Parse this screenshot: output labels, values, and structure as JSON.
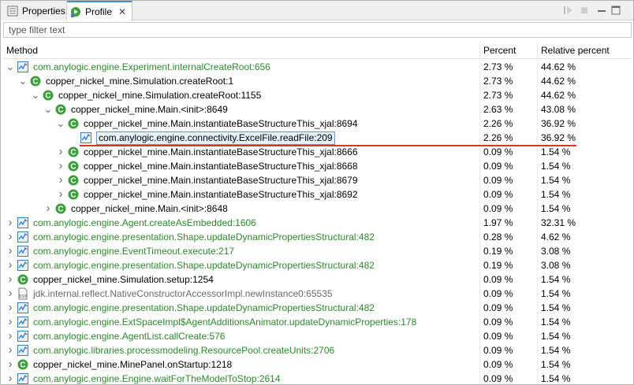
{
  "tabs": {
    "properties_label": "Properties",
    "profile_label": "Profile",
    "close_glyph": "✕"
  },
  "filter": {
    "placeholder": "type filter text"
  },
  "columns": {
    "method": "Method",
    "percent": "Percent",
    "relative": "Relative percent"
  },
  "colors": {
    "green_text": "#2a8a2a",
    "selection": "#e5f1fb",
    "selection_border": "#5b9bd5",
    "annotation": "#e03030",
    "class_icon": "#3e9e3e",
    "method_icon": "#3a7fc6"
  },
  "rows": [
    {
      "depth": 0,
      "expand": "open",
      "icon": "method-icon",
      "color": "green",
      "label": "com.anylogic.engine.Experiment.internalCreateRoot:656",
      "percent": "2.73 %",
      "relative": "44.62 %"
    },
    {
      "depth": 1,
      "expand": "open",
      "icon": "class-icon",
      "color": "black",
      "label": "copper_nickel_mine.Simulation.createRoot:1",
      "percent": "2.73 %",
      "relative": "44.62 %"
    },
    {
      "depth": 2,
      "expand": "open",
      "icon": "class-icon",
      "color": "black",
      "label": "copper_nickel_mine.Simulation.createRoot:1155",
      "percent": "2.73 %",
      "relative": "44.62 %"
    },
    {
      "depth": 3,
      "expand": "open",
      "icon": "class-icon",
      "color": "black",
      "label": "copper_nickel_mine.Main.<init>:8649",
      "percent": "2.63 %",
      "relative": "43.08 %"
    },
    {
      "depth": 4,
      "expand": "open",
      "icon": "class-icon",
      "color": "black",
      "label": "copper_nickel_mine.Main.instantiateBaseStructureThis_xjal:8694",
      "percent": "2.26 %",
      "relative": "36.92 %"
    },
    {
      "depth": 5,
      "expand": "none",
      "icon": "method-icon",
      "color": "black",
      "label": "com.anylogic.engine.connectivity.ExcelFile.readFile:209",
      "percent": "2.26 %",
      "relative": "36.92 %",
      "selected": true
    },
    {
      "depth": 4,
      "expand": "closed",
      "icon": "class-icon",
      "color": "black",
      "label": "copper_nickel_mine.Main.instantiateBaseStructureThis_xjal:8666",
      "percent": "0.09 %",
      "relative": "1.54 %"
    },
    {
      "depth": 4,
      "expand": "closed",
      "icon": "class-icon",
      "color": "black",
      "label": "copper_nickel_mine.Main.instantiateBaseStructureThis_xjal:8668",
      "percent": "0.09 %",
      "relative": "1.54 %"
    },
    {
      "depth": 4,
      "expand": "closed",
      "icon": "class-icon",
      "color": "black",
      "label": "copper_nickel_mine.Main.instantiateBaseStructureThis_xjal:8679",
      "percent": "0.09 %",
      "relative": "1.54 %"
    },
    {
      "depth": 4,
      "expand": "closed",
      "icon": "class-icon",
      "color": "black",
      "label": "copper_nickel_mine.Main.instantiateBaseStructureThis_xjal:8692",
      "percent": "0.09 %",
      "relative": "1.54 %"
    },
    {
      "depth": 3,
      "expand": "closed",
      "icon": "class-icon",
      "color": "black",
      "label": "copper_nickel_mine.Main.<init>:8648",
      "percent": "0.09 %",
      "relative": "1.54 %"
    },
    {
      "depth": 0,
      "expand": "closed",
      "icon": "method-icon",
      "color": "green",
      "label": "com.anylogic.engine.Agent.createAsEmbedded:1606",
      "percent": "1.97 %",
      "relative": "32.31 %"
    },
    {
      "depth": 0,
      "expand": "closed",
      "icon": "method-icon",
      "color": "green",
      "label": "com.anylogic.engine.presentation.Shape.updateDynamicPropertiesStructural:482",
      "percent": "0.28 %",
      "relative": "4.62 %"
    },
    {
      "depth": 0,
      "expand": "closed",
      "icon": "method-icon",
      "color": "green",
      "label": "com.anylogic.engine.EventTimeout.execute:217",
      "percent": "0.19 %",
      "relative": "3.08 %"
    },
    {
      "depth": 0,
      "expand": "closed",
      "icon": "method-icon",
      "color": "green",
      "label": "com.anylogic.engine.presentation.Shape.updateDynamicPropertiesStructural:482",
      "percent": "0.19 %",
      "relative": "3.08 %"
    },
    {
      "depth": 0,
      "expand": "closed",
      "icon": "class-icon",
      "color": "black",
      "label": "copper_nickel_mine.Simulation.setup:1254",
      "percent": "0.09 %",
      "relative": "1.54 %"
    },
    {
      "depth": 0,
      "expand": "closed",
      "icon": "binary-icon",
      "color": "gray",
      "label": "jdk.internal.reflect.NativeConstructorAccessorImpl.newInstance0:65535",
      "percent": "0.09 %",
      "relative": "1.54 %"
    },
    {
      "depth": 0,
      "expand": "closed",
      "icon": "method-icon",
      "color": "green",
      "label": "com.anylogic.engine.presentation.Shape.updateDynamicPropertiesStructural:482",
      "percent": "0.09 %",
      "relative": "1.54 %"
    },
    {
      "depth": 0,
      "expand": "closed",
      "icon": "method-icon",
      "color": "green",
      "label": "com.anylogic.engine.ExtSpaceImpl$AgentAdditionsAnimator.updateDynamicProperties:178",
      "percent": "0.09 %",
      "relative": "1.54 %"
    },
    {
      "depth": 0,
      "expand": "closed",
      "icon": "method-icon",
      "color": "green",
      "label": "com.anylogic.engine.AgentList.callCreate:576",
      "percent": "0.09 %",
      "relative": "1.54 %"
    },
    {
      "depth": 0,
      "expand": "closed",
      "icon": "method-icon",
      "color": "green",
      "label": "com.anylogic.libraries.processmodeling.ResourcePool.createUnits:2706",
      "percent": "0.09 %",
      "relative": "1.54 %"
    },
    {
      "depth": 0,
      "expand": "closed",
      "icon": "class-icon",
      "color": "black",
      "label": "copper_nickel_mine.MinePanel.onStartup:1218",
      "percent": "0.09 %",
      "relative": "1.54 %"
    },
    {
      "depth": 0,
      "expand": "closed",
      "icon": "method-icon",
      "color": "green",
      "label": "com.anylogic.engine.Engine.waitForTheModelToStop:2614",
      "percent": "0.09 %",
      "relative": "1.54 %"
    }
  ]
}
